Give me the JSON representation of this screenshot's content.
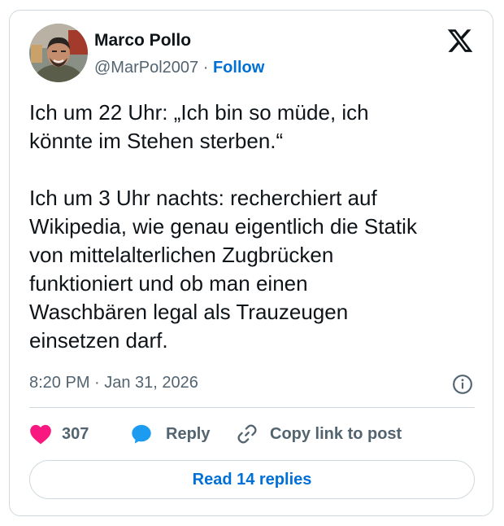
{
  "author": {
    "name": "Marco Pollo",
    "handle": "@MarPol2007",
    "separator": "·",
    "follow_label": "Follow"
  },
  "icons": {
    "platform_logo": "x-logo-icon",
    "info": "info-icon",
    "like": "heart-icon",
    "reply": "speech-bubble-icon",
    "copy_link": "link-icon"
  },
  "tweet": {
    "text": "Ich um 22 Uhr: „Ich bin so müde, ich\nkönnte im Stehen sterben.“\n\nIch um 3 Uhr nachts: recherchiert auf\nWikipedia, wie genau eigentlich die Statik\nvon mittelalterlichen Zugbrücken\nfunktioniert und ob man einen\nWaschbären legal als Trauzeugen\neinsetzen darf.",
    "timestamp": "8:20 PM · Jan 31, 2026"
  },
  "actions": {
    "likes_count": "307",
    "reply_label": "Reply",
    "copy_link_label": "Copy link to post"
  },
  "read_replies_label": "Read 14 replies",
  "colors": {
    "like": "#f91880",
    "reply": "#1d9bf0",
    "link": "#006fd6",
    "secondary_text": "#536471",
    "border": "#cfd9de"
  }
}
